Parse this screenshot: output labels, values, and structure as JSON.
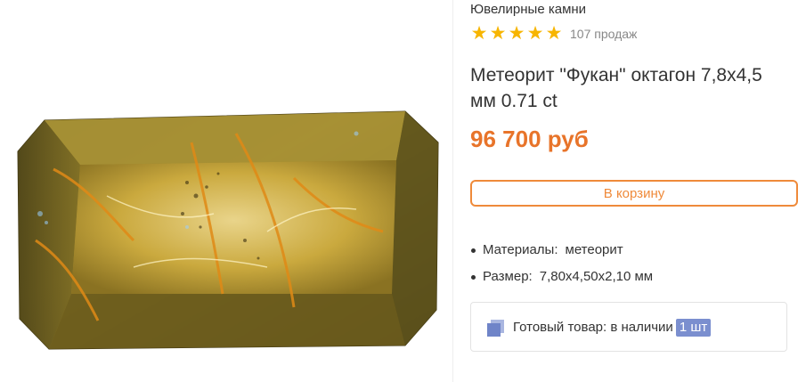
{
  "product": {
    "image_alt": "meteorite-gemstone-photo",
    "category": "Ювелирные камни",
    "rating_stars": 5,
    "rating_max": 5,
    "sales_text": "107 продаж",
    "title": "Метеорит \"Фукан\" октагон 7,8x4,5 мм 0.71 ct",
    "price": "96 700 руб",
    "cart_button_label": "В корзину",
    "specs": [
      {
        "label": "Материалы:",
        "value": "метеорит"
      },
      {
        "label": "Размер:",
        "value": "7,80x4,50x2,10 мм"
      }
    ],
    "stock": {
      "text": "Готовый товар: в наличии",
      "quantity": "1 шт",
      "icon": "stack-icon"
    }
  },
  "colors": {
    "accent": "#e8742a",
    "star": "#f7b500",
    "badge": "#7b8fcf"
  }
}
